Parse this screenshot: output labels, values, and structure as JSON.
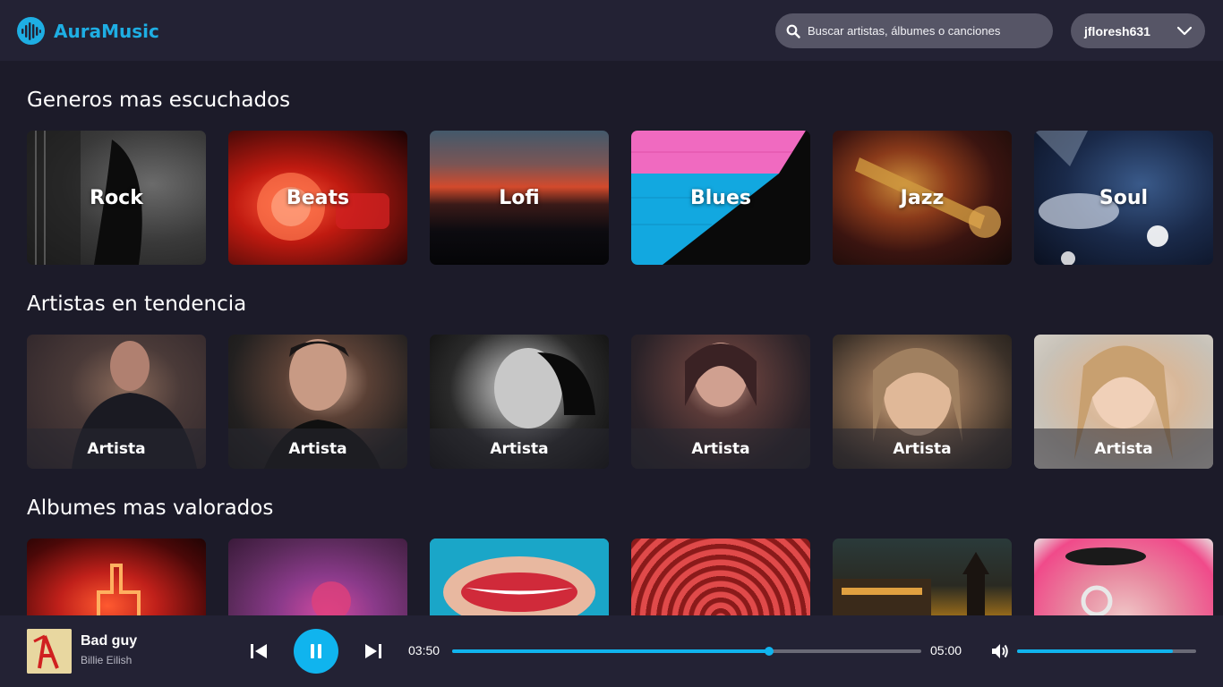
{
  "app": {
    "name": "AuraMusic",
    "accent": "#1eaee3"
  },
  "header": {
    "search_placeholder": "Buscar artistas, álbumes o canciones",
    "username": "jfloresh631"
  },
  "sections": {
    "genres": {
      "title": "Generos mas escuchados",
      "items": [
        {
          "label": "Rock"
        },
        {
          "label": "Beats"
        },
        {
          "label": "Lofi"
        },
        {
          "label": "Blues"
        },
        {
          "label": "Jazz"
        },
        {
          "label": "Soul"
        }
      ]
    },
    "artists": {
      "title": "Artistas en tendencia",
      "items": [
        {
          "label": "Artista"
        },
        {
          "label": "Artista"
        },
        {
          "label": "Artista"
        },
        {
          "label": "Artista"
        },
        {
          "label": "Artista"
        },
        {
          "label": "Artista"
        }
      ]
    },
    "albums": {
      "title": "Albumes mas valorados"
    }
  },
  "player": {
    "song_title": "Bad guy",
    "song_artist": "Billie Eilish",
    "current_time": "03:50",
    "total_time": "05:00",
    "progress": 0.676,
    "volume": 0.87,
    "state": "playing"
  }
}
